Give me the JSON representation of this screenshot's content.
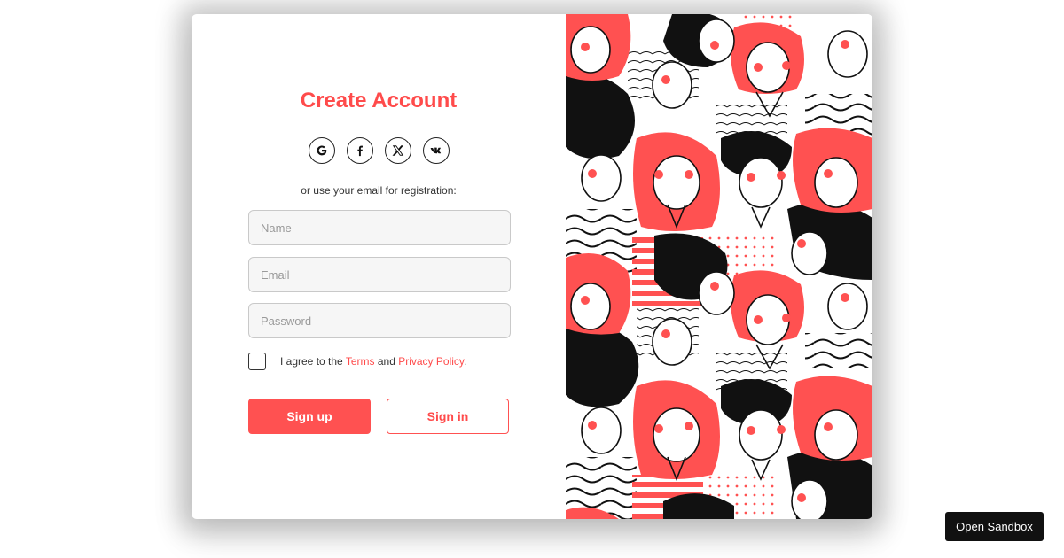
{
  "form": {
    "title": "Create Account",
    "socials": [
      {
        "icon": "google-icon",
        "glyph": "G"
      },
      {
        "icon": "facebook-icon",
        "glyph": "f"
      },
      {
        "icon": "x-icon",
        "glyph": "X"
      },
      {
        "icon": "vk-icon",
        "glyph": "VK"
      }
    ],
    "subtitle": "or use your email for registration:",
    "name_placeholder": "Name",
    "email_placeholder": "Email",
    "password_placeholder": "Password",
    "agree_prefix": "I agree to the ",
    "terms_link": "Terms",
    "agree_and": " and ",
    "privacy_link": "Privacy Policy",
    "agree_suffix": ".",
    "signup_label": "Sign up",
    "signin_label": "Sign in"
  },
  "illustration": {
    "icon": "crowd-of-women-illustration",
    "colors": {
      "accent": "#ff5151",
      "ink": "#111111",
      "paper": "#ffffff"
    }
  },
  "sandbox_button": "Open Sandbox"
}
